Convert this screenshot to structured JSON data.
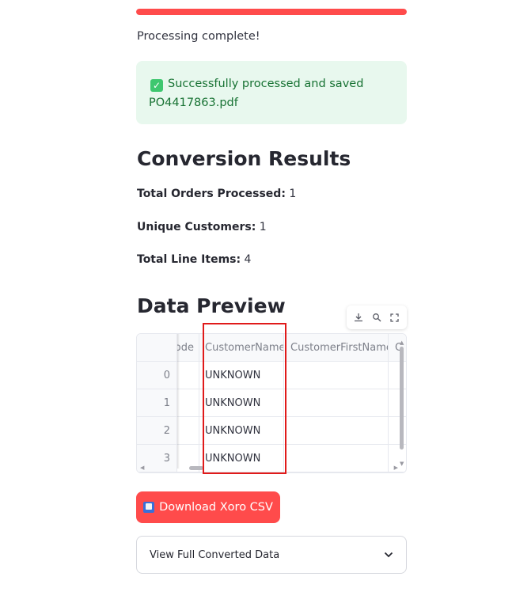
{
  "progress": {
    "value": 1.0,
    "color": "#ff4b4b"
  },
  "status_text": "Processing complete!",
  "success": {
    "icon": "check-mark-icon",
    "text": "Successfully processed and saved PO4417863.pdf",
    "line1": "Successfully processed and saved",
    "line2": "PO4417863.pdf",
    "color": "#177233",
    "background": "#e8f8ee"
  },
  "results": {
    "title": "Conversion Results",
    "stats": [
      {
        "label": "Total Orders Processed:",
        "value": "1"
      },
      {
        "label": "Unique Customers:",
        "value": "1"
      },
      {
        "label": "Total Line Items:",
        "value": "4"
      }
    ]
  },
  "preview": {
    "title": "Data Preview",
    "toolbar": [
      "download-icon",
      "search-icon",
      "fullscreen-icon"
    ],
    "columns": [
      "ode",
      "CustomerName",
      "CustomerFirstName",
      "C"
    ],
    "rows": [
      {
        "index": "0",
        "customer_name": "UNKNOWN",
        "customer_first_name": ""
      },
      {
        "index": "1",
        "customer_name": "UNKNOWN",
        "customer_first_name": ""
      },
      {
        "index": "2",
        "customer_name": "UNKNOWN",
        "customer_first_name": ""
      },
      {
        "index": "3",
        "customer_name": "UNKNOWN",
        "customer_first_name": ""
      }
    ],
    "highlight_color": "#e01a1a"
  },
  "download_button": {
    "icon": "book-icon",
    "label": "Download Xoro CSV",
    "color": "#ff4b4b"
  },
  "expander": {
    "label": "View Full Converted Data",
    "icon": "chevron-down-icon"
  }
}
